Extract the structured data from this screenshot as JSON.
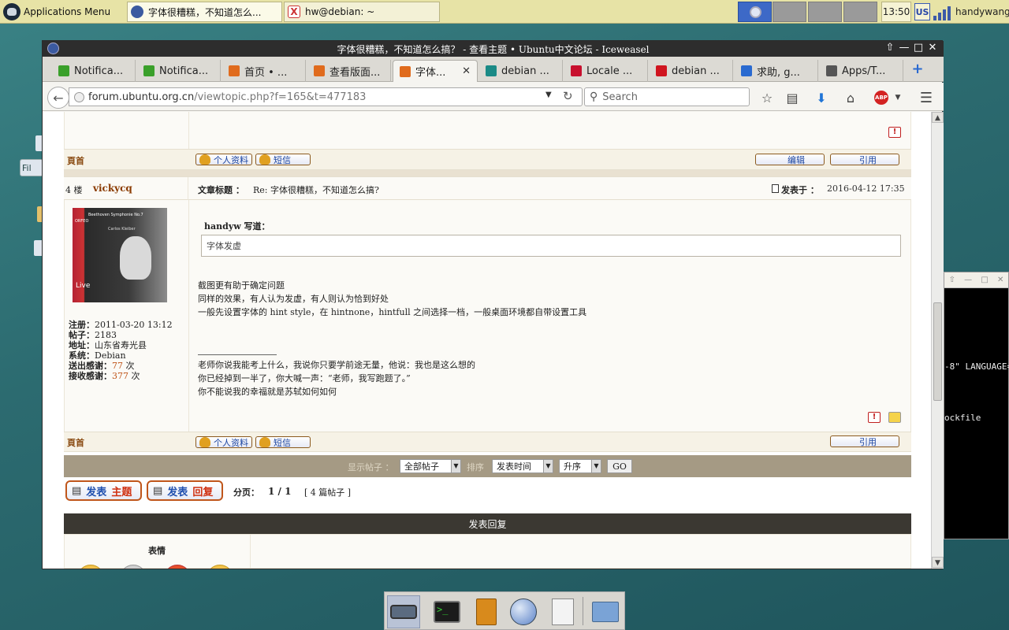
{
  "panel": {
    "apps_menu": "Applications Menu",
    "tasks": [
      {
        "label": "字体很糟糕，不知道怎么..."
      },
      {
        "label": "hw@debian: ~"
      }
    ],
    "clock": "13:50",
    "keyboard": "US",
    "user": "handywang"
  },
  "desktop": {
    "icon_label": "Fil"
  },
  "terminal": {
    "lines": [
      "-8\" LANGUAGE=",
      "ockfile"
    ]
  },
  "browser": {
    "title": "字体很糟糕，不知道怎么搞？ - 查看主题 • Ubuntu中文论坛 - Iceweasel",
    "tabs": [
      {
        "label": "Notifica...",
        "color": "#3aa02a"
      },
      {
        "label": "Notifica...",
        "color": "#3aa02a"
      },
      {
        "label": "首页 • ...",
        "color": "#e06b1d"
      },
      {
        "label": "查看版面...",
        "color": "#e06b1d"
      },
      {
        "label": "字体...",
        "color": "#e06b1d",
        "selected": true
      },
      {
        "label": "debian ...",
        "color": "#1a8a86"
      },
      {
        "label": "Locale ...",
        "color": "#c8102e"
      },
      {
        "label": "debian ...",
        "color": "#d0151f"
      },
      {
        "label": "求助, g...",
        "color": "#2a6ad0"
      },
      {
        "label": "Apps/T...",
        "color": "#555555"
      }
    ],
    "url_host": "forum.ubuntu.org.cn",
    "url_path": "/viewtopic.php?f=165&t=477183",
    "search_placeholder": "Search"
  },
  "forum": {
    "top_label": "頁首",
    "profile_btn": "个人资料",
    "pm_btn": "短信",
    "edit_btn": "编辑",
    "quote_btn": "引用",
    "post": {
      "floor": "4 楼",
      "author": "vickycq",
      "subject_label": "文章标题 ：",
      "subject": "Re: 字体很糟糕，不知道怎么搞?",
      "posted_label": "发表于 ：",
      "posted": "2016-04-12 17:35",
      "avatar": {
        "l1": "Beethoven Symphonie No.7",
        "l2": "Carlos Kleiber",
        "l3": "ORFEO",
        "l4": "Live"
      },
      "info": [
        {
          "label": "注册：",
          "value": "2011-03-20 13:12"
        },
        {
          "label": "帖子：",
          "value": "2183"
        },
        {
          "label": "地址：",
          "value": "山东省寿光县"
        },
        {
          "label": "系统：",
          "value": "Debian"
        },
        {
          "label": "送出感谢：",
          "value": "77",
          "suffix": " 次"
        },
        {
          "label": "接收感谢：",
          "value": "377",
          "suffix": " 次"
        }
      ],
      "quote_author": "handyw 写道：",
      "quote_text": "字体发虚",
      "body": [
        "截图更有助于确定问题",
        "同样的效果，有人认为发虚，有人则认为恰到好处",
        "一般先设置字体的 hint style，在 hintnone，hintfull 之间选择一档，一般桌面环境都自带设置工具"
      ],
      "signature": [
        "老师你说我能考上什么，我说你只要学前途无量，他说：我也是这么想的",
        "你已经掉到一半了，你大喊一声：“老师，我写跑题了。”",
        "你不能说我的幸福就是苏轼如何如何"
      ]
    },
    "controls": {
      "show_label": "显示帖子 ：",
      "show_value": "全部帖子",
      "sort_label": "排序",
      "sort_value": "发表时间",
      "order_value": "升序",
      "go": "GO"
    },
    "new_topic_a": "发表",
    "new_topic_b": "主题",
    "reply_a": "发表",
    "reply_b": "回复",
    "pagination_label": "分页：",
    "pagination": "1 / 1",
    "post_count": "[ 4 篇帖子 ]",
    "reply_header": "发表回复",
    "emoticons_label": "表情"
  }
}
